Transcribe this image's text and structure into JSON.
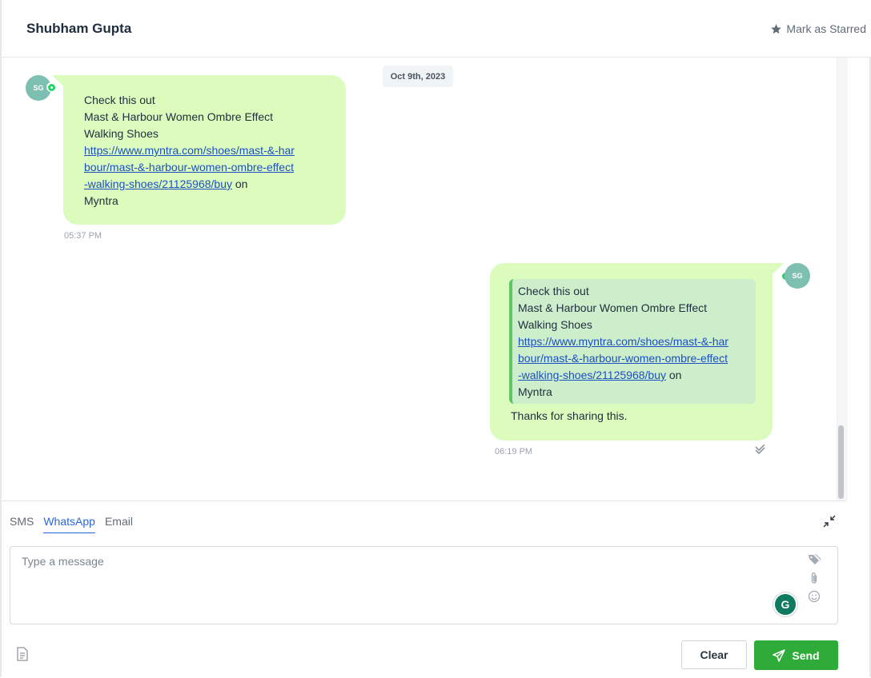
{
  "header": {
    "contact_name": "Shubham Gupta",
    "star_label": "Mark as Starred",
    "star_icon": "star-icon"
  },
  "conversation": {
    "date_divider": "Oct 9th, 2023",
    "messages": [
      {
        "direction": "incoming",
        "channel": "whatsapp",
        "avatar_initials": "SG",
        "line1": "Check this out",
        "line2": "Mast & Harbour Women Ombre Effect Walking Shoes",
        "link": "https://www.myntra.com/shoes/mast-&-harbour/mast-&-harbour-women-ombre-effect-walking-shoes/21125968/buy",
        "suffix": " on",
        "source": "Myntra",
        "time": "05:37 PM"
      },
      {
        "direction": "outgoing",
        "channel": "whatsapp",
        "avatar_initials": "SG",
        "quoted": {
          "line1": "Check this out",
          "line2": "Mast & Harbour Women Ombre Effect Walking Shoes",
          "link": "https://www.myntra.com/shoes/mast-&-harbour/mast-&-harbour-women-ombre-effect-walking-shoes/21125968/buy",
          "suffix": " on",
          "source": "Myntra"
        },
        "text": "Thanks for sharing this.",
        "time": "06:19 PM",
        "status_icon": "double-check-icon"
      }
    ]
  },
  "composer": {
    "tabs": [
      {
        "label": "SMS",
        "active": false
      },
      {
        "label": "WhatsApp",
        "active": true
      },
      {
        "label": "Email",
        "active": false
      }
    ],
    "placeholder": "Type a message",
    "value": "",
    "clear_label": "Clear",
    "send_label": "Send",
    "grammarly_label": "G"
  },
  "colors": {
    "bubble": "#dcfcbe",
    "quote": "#cdeecb",
    "accent_tab": "#2a66d8",
    "send_button": "#2eab38",
    "avatar": "#7dbfb1",
    "link": "#1b4fc4"
  }
}
